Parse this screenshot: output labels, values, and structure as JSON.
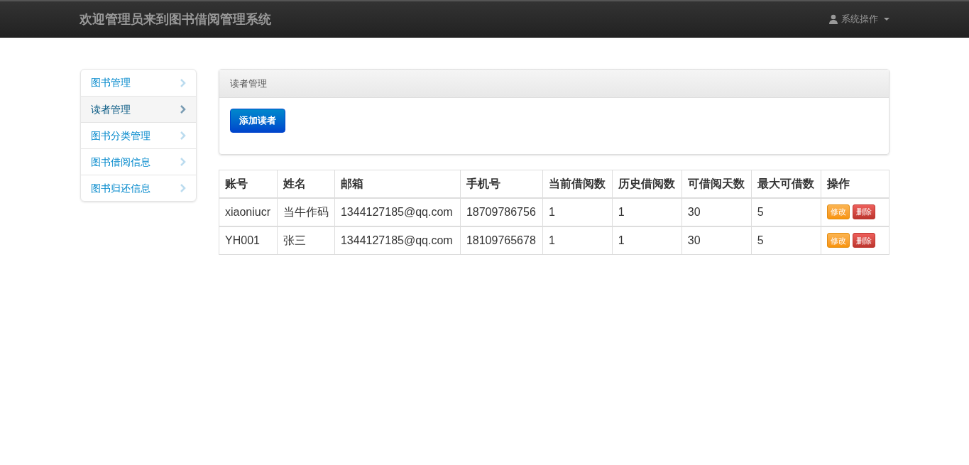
{
  "navbar": {
    "title": "欢迎管理员来到图书借阅管理系统",
    "menu": "系统操作"
  },
  "sidebar": {
    "items": [
      {
        "label": "图书管理",
        "selected": false
      },
      {
        "label": "读者管理",
        "selected": true
      },
      {
        "label": "图书分类管理",
        "selected": false
      },
      {
        "label": "图书借阅信息",
        "selected": false
      },
      {
        "label": "图书归还信息",
        "selected": false
      }
    ]
  },
  "panel": {
    "title": "读者管理",
    "button": "添加读者"
  },
  "table": {
    "columns": [
      "账号",
      "姓名",
      "邮箱",
      "手机号",
      "当前借阅数",
      "历史借阅数",
      "可借阅天数",
      "最大可借数",
      "操作"
    ],
    "rows": [
      {
        "cells": [
          "xiaoniucr",
          "当牛作码",
          "1344127185@qq.com",
          "18709786756",
          "1",
          "1",
          "30",
          "5"
        ],
        "actions": [
          {
            "kind": "edit",
            "label": "修改"
          },
          {
            "kind": "delete",
            "label": "删除"
          }
        ]
      },
      {
        "cells": [
          "YH001",
          "张三",
          "1344127185@qq.com",
          "18109765678",
          "1",
          "1",
          "30",
          "5"
        ],
        "actions": [
          {
            "kind": "edit",
            "label": "修改"
          },
          {
            "kind": "delete",
            "label": "删除"
          }
        ]
      }
    ]
  }
}
